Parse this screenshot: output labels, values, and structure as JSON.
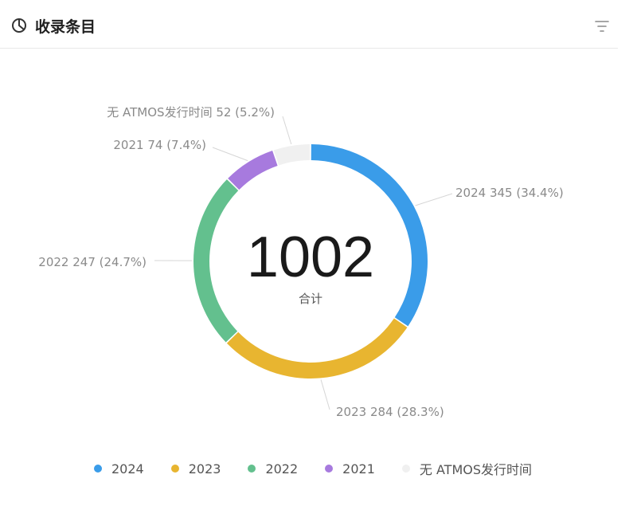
{
  "header": {
    "title": "收录条目",
    "icon": "pie-chart-icon",
    "filter_icon": "filter-icon"
  },
  "chart_data": {
    "type": "pie",
    "donut": true,
    "total": {
      "value": "1002",
      "label": "合计"
    },
    "slices": [
      {
        "name": "2024",
        "value": 345,
        "percent": "34.4%",
        "color": "#3a9ce9"
      },
      {
        "name": "2023",
        "value": 284,
        "percent": "28.3%",
        "color": "#e8b530"
      },
      {
        "name": "2022",
        "value": 247,
        "percent": "24.7%",
        "color": "#63c08e"
      },
      {
        "name": "2021",
        "value": 74,
        "percent": "7.4%",
        "color": "#a77ade"
      },
      {
        "name": "无 ATMOS发行时间",
        "value": 52,
        "percent": "5.2%",
        "color": "#f0f0f0"
      }
    ],
    "legend_position": "bottom"
  }
}
